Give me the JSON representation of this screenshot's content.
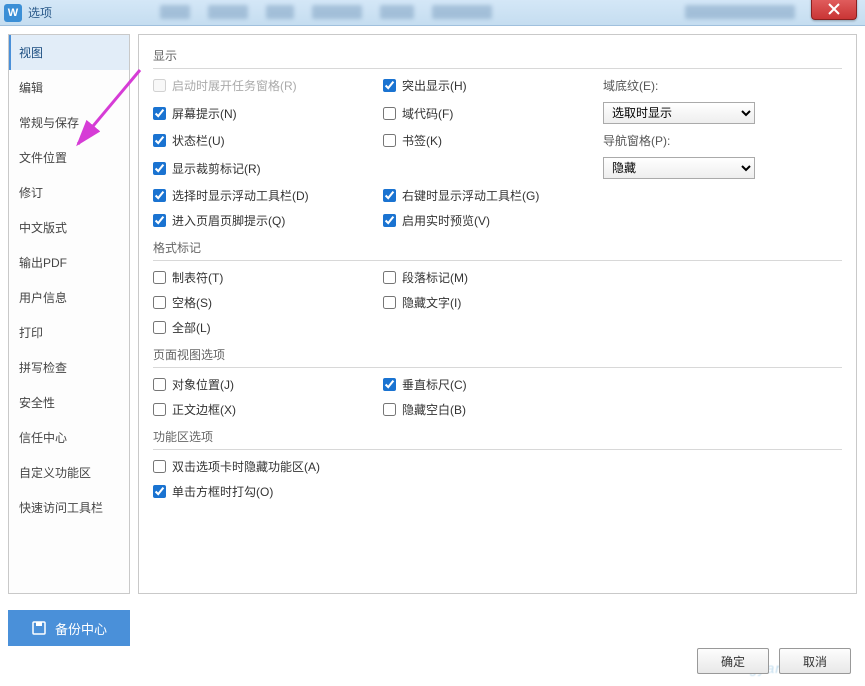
{
  "window": {
    "title": "选项"
  },
  "sidebar": {
    "items": [
      "视图",
      "编辑",
      "常规与保存",
      "文件位置",
      "修订",
      "中文版式",
      "输出PDF",
      "用户信息",
      "打印",
      "拼写检查",
      "安全性",
      "信任中心",
      "自定义功能区",
      "快速访问工具栏"
    ],
    "selected": 0
  },
  "groups": {
    "display": {
      "title": "显示",
      "startup_pane": "启动时展开任务窗格(R)",
      "highlight": "突出显示(H)",
      "field_shading_label": "域底纹(E):",
      "field_shading_value": "选取时显示",
      "screen_tip": "屏幕提示(N)",
      "field_code": "域代码(F)",
      "status_bar": "状态栏(U)",
      "bookmark": "书签(K)",
      "nav_pane_label": "导航窗格(P):",
      "nav_pane_value": "隐藏",
      "crop_marks": "显示裁剪标记(R)",
      "sel_float_toolbar": "选择时显示浮动工具栏(D)",
      "rclick_float_toolbar": "右键时显示浮动工具栏(G)",
      "header_footer_tip": "进入页眉页脚提示(Q)",
      "live_preview": "启用实时预览(V)"
    },
    "format_marks": {
      "title": "格式标记",
      "tab": "制表符(T)",
      "para": "段落标记(M)",
      "space": "空格(S)",
      "hidden": "隐藏文字(I)",
      "all": "全部(L)"
    },
    "page_view": {
      "title": "页面视图选项",
      "obj_pos": "对象位置(J)",
      "v_ruler": "垂直标尺(C)",
      "text_border": "正文边框(X)",
      "hide_blank": "隐藏空白(B)"
    },
    "ribbon": {
      "title": "功能区选项",
      "dblclick_hide": "双击选项卡时隐藏功能区(A)",
      "click_check": "单击方框时打勾(O)"
    }
  },
  "backup_button": "备份中心",
  "footer": {
    "ok": "确定",
    "cancel": "取消"
  }
}
